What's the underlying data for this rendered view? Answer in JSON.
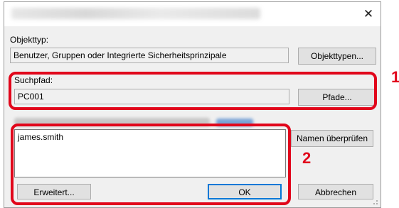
{
  "window": {
    "close_glyph": "✕"
  },
  "object_type": {
    "label": "Objekttyp:",
    "value": "Benutzer, Gruppen oder Integrierte Sicherheitsprinzipale",
    "button": "Objekttypen..."
  },
  "search_path": {
    "label": "Suchpfad:",
    "value": "PC001",
    "button": "Pfade..."
  },
  "names": {
    "value": "james.smith",
    "check_button": "Namen überprüfen"
  },
  "footer": {
    "advanced_button": "Erweitert...",
    "ok_button": "OK",
    "cancel_button": "Abbrechen"
  },
  "callouts": {
    "one": "1",
    "two": "2"
  },
  "colors": {
    "callout": "#e1061b",
    "accent": "#0078d7",
    "dialog_bg": "#f0f0f0"
  }
}
